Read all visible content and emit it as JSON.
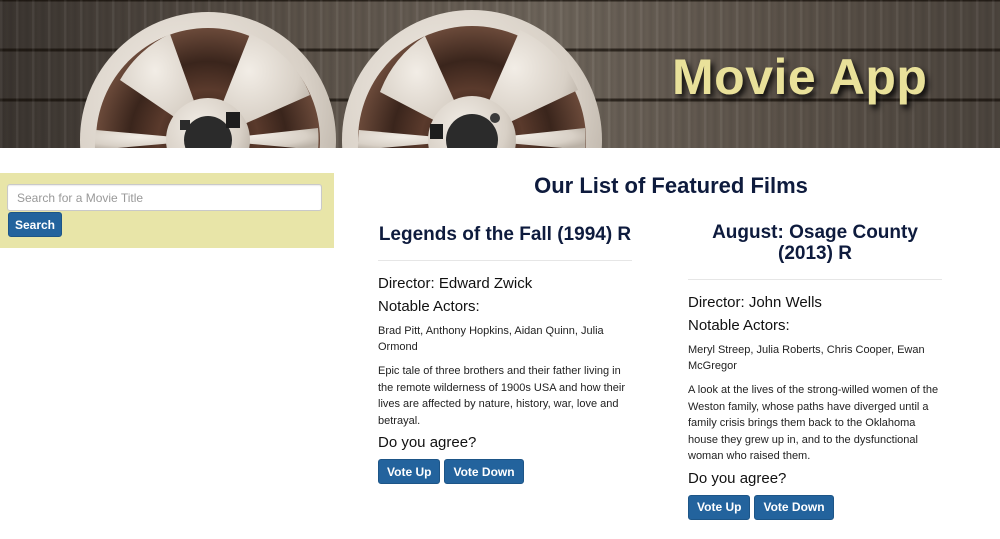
{
  "header": {
    "app_title": "Movie App"
  },
  "search": {
    "placeholder": "Search for a Movie Title",
    "value": "",
    "button_label": "Search"
  },
  "main": {
    "heading": "Our List of Featured Films",
    "films": [
      {
        "title": "Legends of the Fall (1994) R",
        "director": "Director: Edward Zwick",
        "actors_heading": "Notable Actors:",
        "actors": "Brad Pitt, Anthony Hopkins, Aidan Quinn, Julia Ormond",
        "description": "Epic tale of three brothers and their father living in the remote wilderness of 1900s USA and how their lives are affected by nature, history, war, love and betrayal.",
        "prompt": "Do you agree?",
        "vote_up_label": "Vote Up",
        "vote_down_label": "Vote Down"
      },
      {
        "title": "August: Osage County (2013) R",
        "director": "Director: John Wells",
        "actors_heading": "Notable Actors:",
        "actors": "Meryl Streep, Julia Roberts, Chris Cooper, Ewan McGregor",
        "description": "A look at the lives of the strong-willed women of the Weston family, whose paths have diverged until a family crisis brings them back to the Oklahoma house they grew up in, and to the dysfunctional woman who raised them.",
        "prompt": "Do you agree?",
        "vote_up_label": "Vote Up",
        "vote_down_label": "Vote Down"
      }
    ]
  },
  "colors": {
    "button": "#23639d",
    "search_panel": "#e8e5a8",
    "title_text": "#e9e19a",
    "heading_text": "#0e1b3d"
  },
  "icons": [
    "film-reel-icon",
    "film-reel-icon"
  ]
}
